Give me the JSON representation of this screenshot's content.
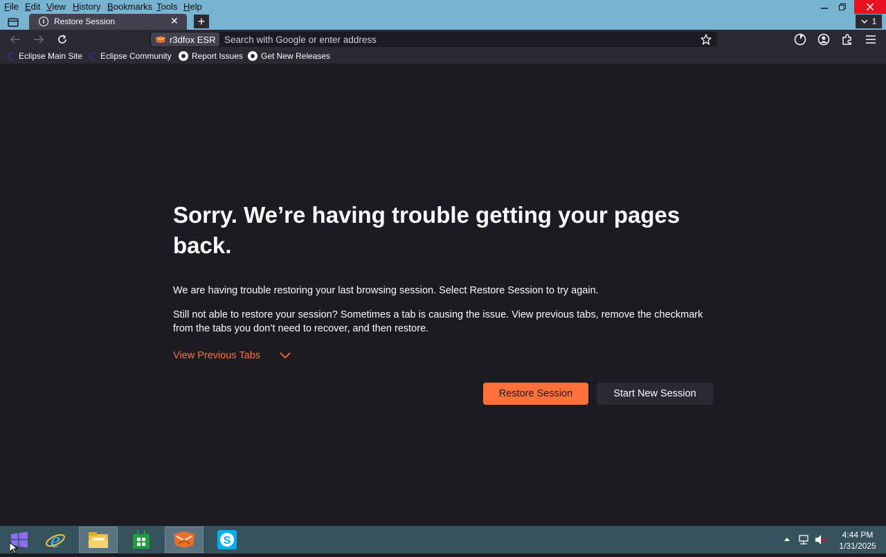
{
  "menu": {
    "items": [
      "File",
      "Edit",
      "View",
      "History",
      "Bookmarks",
      "Tools",
      "Help"
    ]
  },
  "window_controls": [
    "minimize-icon",
    "restore-icon",
    "close-icon"
  ],
  "tab": {
    "title": "Restore Session",
    "close_glyph": "✕",
    "info_glyph": "i"
  },
  "new_tab_glyph": "+",
  "list_all_tabs_count": "1",
  "toolbar": {
    "identity_label": "r3dfox ESR",
    "url_value": "",
    "url_placeholder": "Search with Google or enter address"
  },
  "bookmarks": [
    {
      "label": "Eclipse Main Site",
      "icon": "eclipse-icon"
    },
    {
      "label": "Eclipse Community",
      "icon": "eclipse-icon"
    },
    {
      "label": "Report Issues",
      "icon": "github-icon"
    },
    {
      "label": "Get New Releases",
      "icon": "github-icon"
    }
  ],
  "content": {
    "heading": "Sorry. We’re having trouble getting your pages back.",
    "para1": "We are having trouble restoring your last browsing session. Select Restore Session to try again.",
    "para2": "Still not able to restore your session? Sometimes a tab is causing the issue. View previous tabs, remove the checkmark from the tabs you don’t need to recover, and then restore.",
    "view_previous": "View Previous Tabs",
    "restore_button": "Restore Session",
    "new_session_button": "Start New Session"
  },
  "taskbar": {
    "items": [
      "windows-start-icon",
      "internet-explorer-icon",
      "file-explorer-icon",
      "store-icon",
      "r3dfox-icon",
      "skype-icon"
    ],
    "time": "4:44 PM",
    "date": "1/31/2025"
  },
  "colors": {
    "accent": "#ff7139",
    "chrome_frame": "#77b4d1",
    "toolbar": "#2b2a33",
    "page_bg": "#1c1b22",
    "taskbar": "#36525d"
  }
}
